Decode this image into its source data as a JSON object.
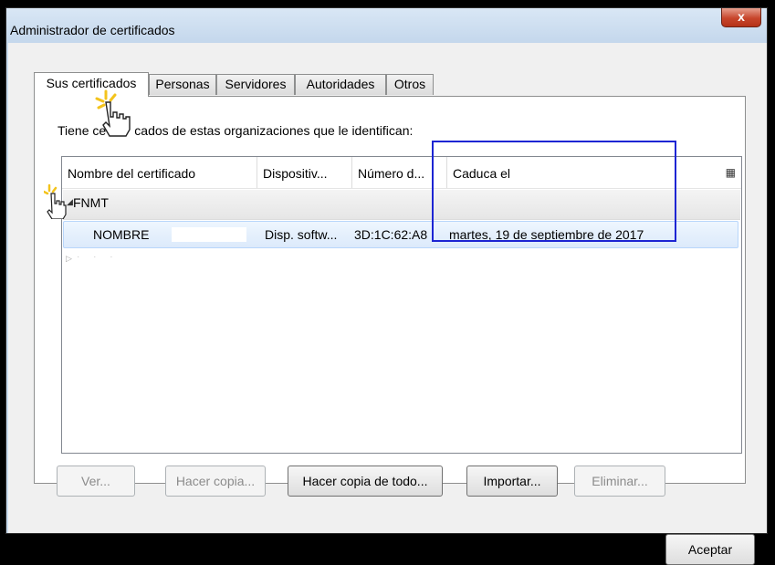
{
  "window": {
    "title": "Administrador de certificados",
    "close_label": "x"
  },
  "tabs": [
    {
      "label": "Sus certificados",
      "active": true
    },
    {
      "label": "Personas",
      "active": false
    },
    {
      "label": "Servidores",
      "active": false
    },
    {
      "label": "Autoridades",
      "active": false
    },
    {
      "label": "Otros",
      "active": false
    }
  ],
  "intro_text": "Tiene ce        cados de estas organizaciones que le identifican:",
  "table": {
    "columns": [
      "Nombre del certificado",
      "Dispositiv...",
      "Número d...",
      "Caduca el"
    ],
    "group": {
      "label": "FNMT"
    },
    "row": {
      "name": "NOMBRE",
      "device": "Disp. softw...",
      "number": "3D:1C:62:A8",
      "expires": "martes, 19 de septiembre de 2017"
    },
    "collapsed_row_text": "· · ·"
  },
  "buttons": {
    "view": "Ver...",
    "backup": "Hacer copia...",
    "backup_all": "Hacer copia de todo...",
    "import": "Importar...",
    "delete": "Eliminar...",
    "ok": "Aceptar"
  },
  "icons": {
    "column_picker": "column-picker-icon",
    "close": "close-icon",
    "cursor": "hand-cursor-icon"
  },
  "colors": {
    "highlight": "#1d25d3",
    "close_button": "#c7452b",
    "selection": "#dceafb"
  }
}
